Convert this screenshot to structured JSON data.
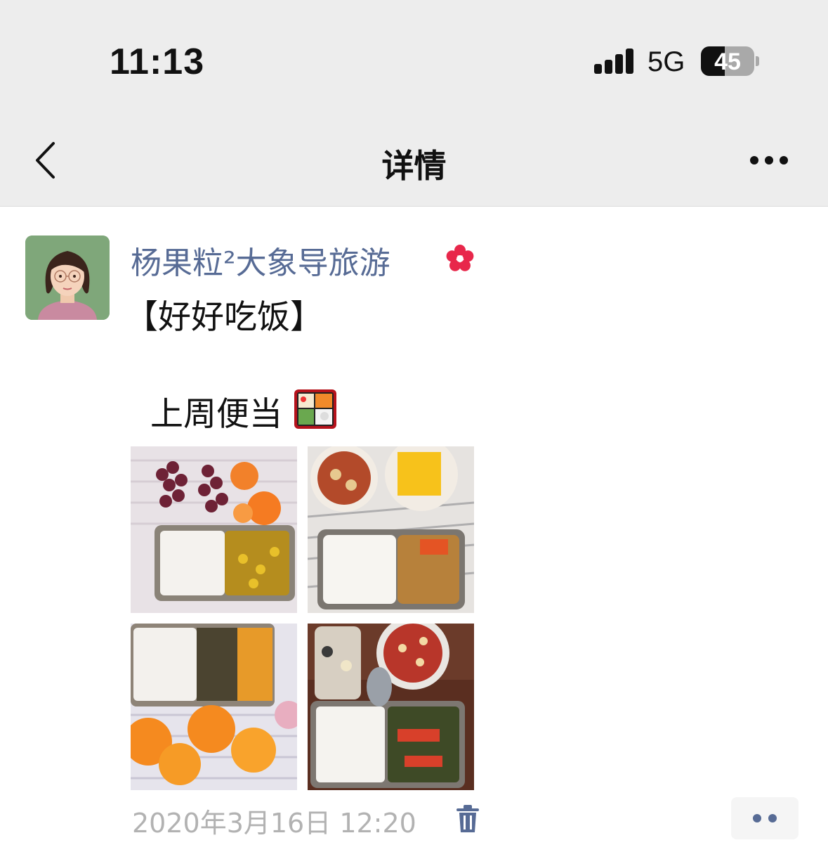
{
  "status_bar": {
    "time": "11:13",
    "network": "5G",
    "battery": "45",
    "battery_level": 0.45
  },
  "nav": {
    "title": "详情"
  },
  "post": {
    "author": "杨果粒²大象导旅游",
    "line1": "【好好吃饭】",
    "line2": "上周便当",
    "timestamp": "2020年3月16日 12:20",
    "photo_count": 4
  },
  "colors": {
    "nav_background": "#ededed",
    "author_name": "#576b95",
    "timestamp": "#b2b2b2",
    "flower_badge": "#e8274b"
  },
  "icons": [
    "back-chevron-icon",
    "more-dots-icon",
    "flower-badge-icon",
    "bento-box-emoji-icon",
    "trash-icon",
    "comment-dots-icon"
  ]
}
